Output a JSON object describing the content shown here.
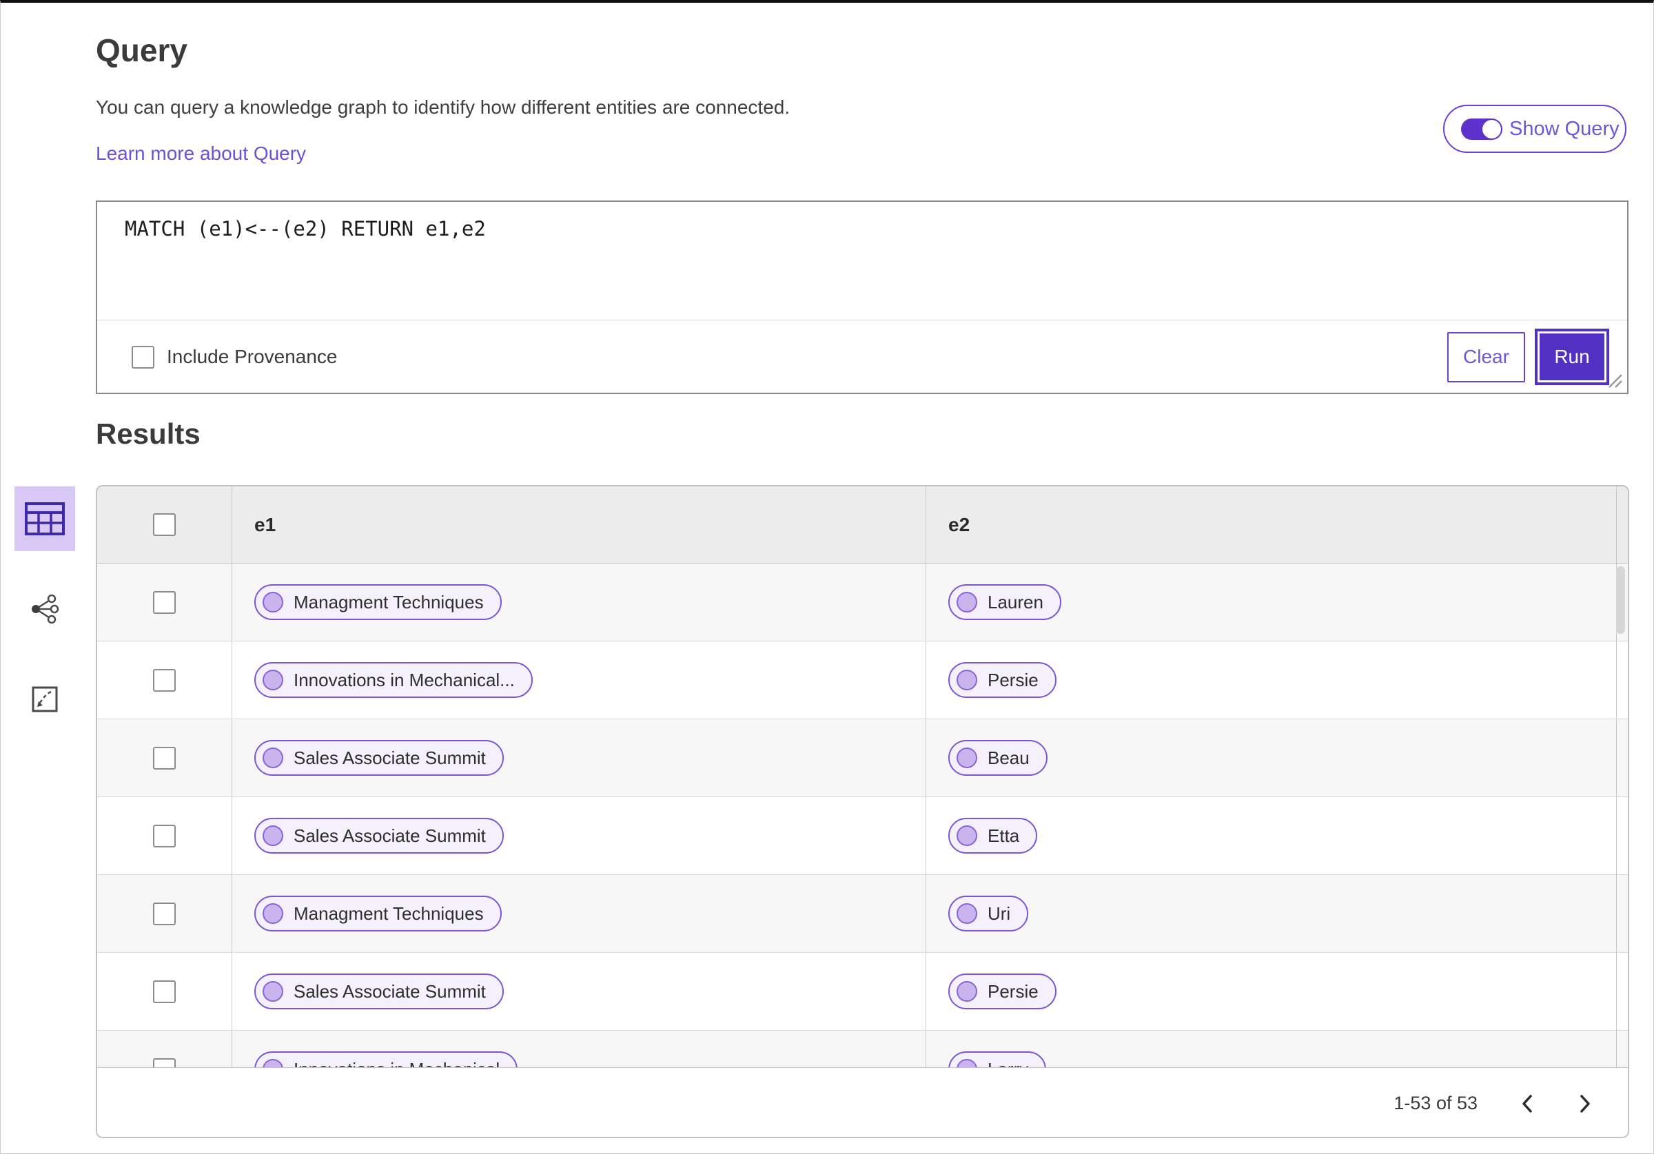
{
  "header": {
    "title": "Query",
    "description": "You can query a knowledge graph to identify how different entities are connected.",
    "learn_more_link": "Learn more about Query",
    "show_query_label": "Show Query",
    "show_query_toggle_on": true
  },
  "query_editor": {
    "query_text": "MATCH (e1)<--(e2) RETURN e1,e2",
    "include_provenance_label": "Include Provenance",
    "include_provenance_checked": false,
    "clear_button_label": "Clear",
    "run_button_label": "Run"
  },
  "results": {
    "title": "Results",
    "view_switcher": {
      "active_view": "table-view",
      "icons": [
        "table-view-icon",
        "graph-view-icon",
        "expand-view-icon"
      ]
    },
    "table": {
      "columns": [
        "e1",
        "e2"
      ],
      "rows": [
        {
          "e1": "Managment Techniques",
          "e2": "Lauren"
        },
        {
          "e1": "Innovations in Mechanical...",
          "e2": "Persie"
        },
        {
          "e1": "Sales Associate Summit",
          "e2": "Beau"
        },
        {
          "e1": "Sales Associate Summit",
          "e2": "Etta"
        },
        {
          "e1": "Managment Techniques",
          "e2": "Uri"
        },
        {
          "e1": "Sales Associate Summit",
          "e2": "Persie"
        },
        {
          "e1": "Innovations in Mechanical",
          "e2": "Larry"
        }
      ],
      "pagination": {
        "range_text": "1-53 of 53"
      }
    }
  },
  "colors": {
    "accent_purple": "#5230c4",
    "pill_border_purple": "#7a55d8",
    "pill_background": "#f5f1fc",
    "link_purple": "#6f50d8",
    "active_view_background": "#d9c8f6",
    "table_header_background": "#ececec",
    "row_stripe": "#f7f7f7"
  }
}
